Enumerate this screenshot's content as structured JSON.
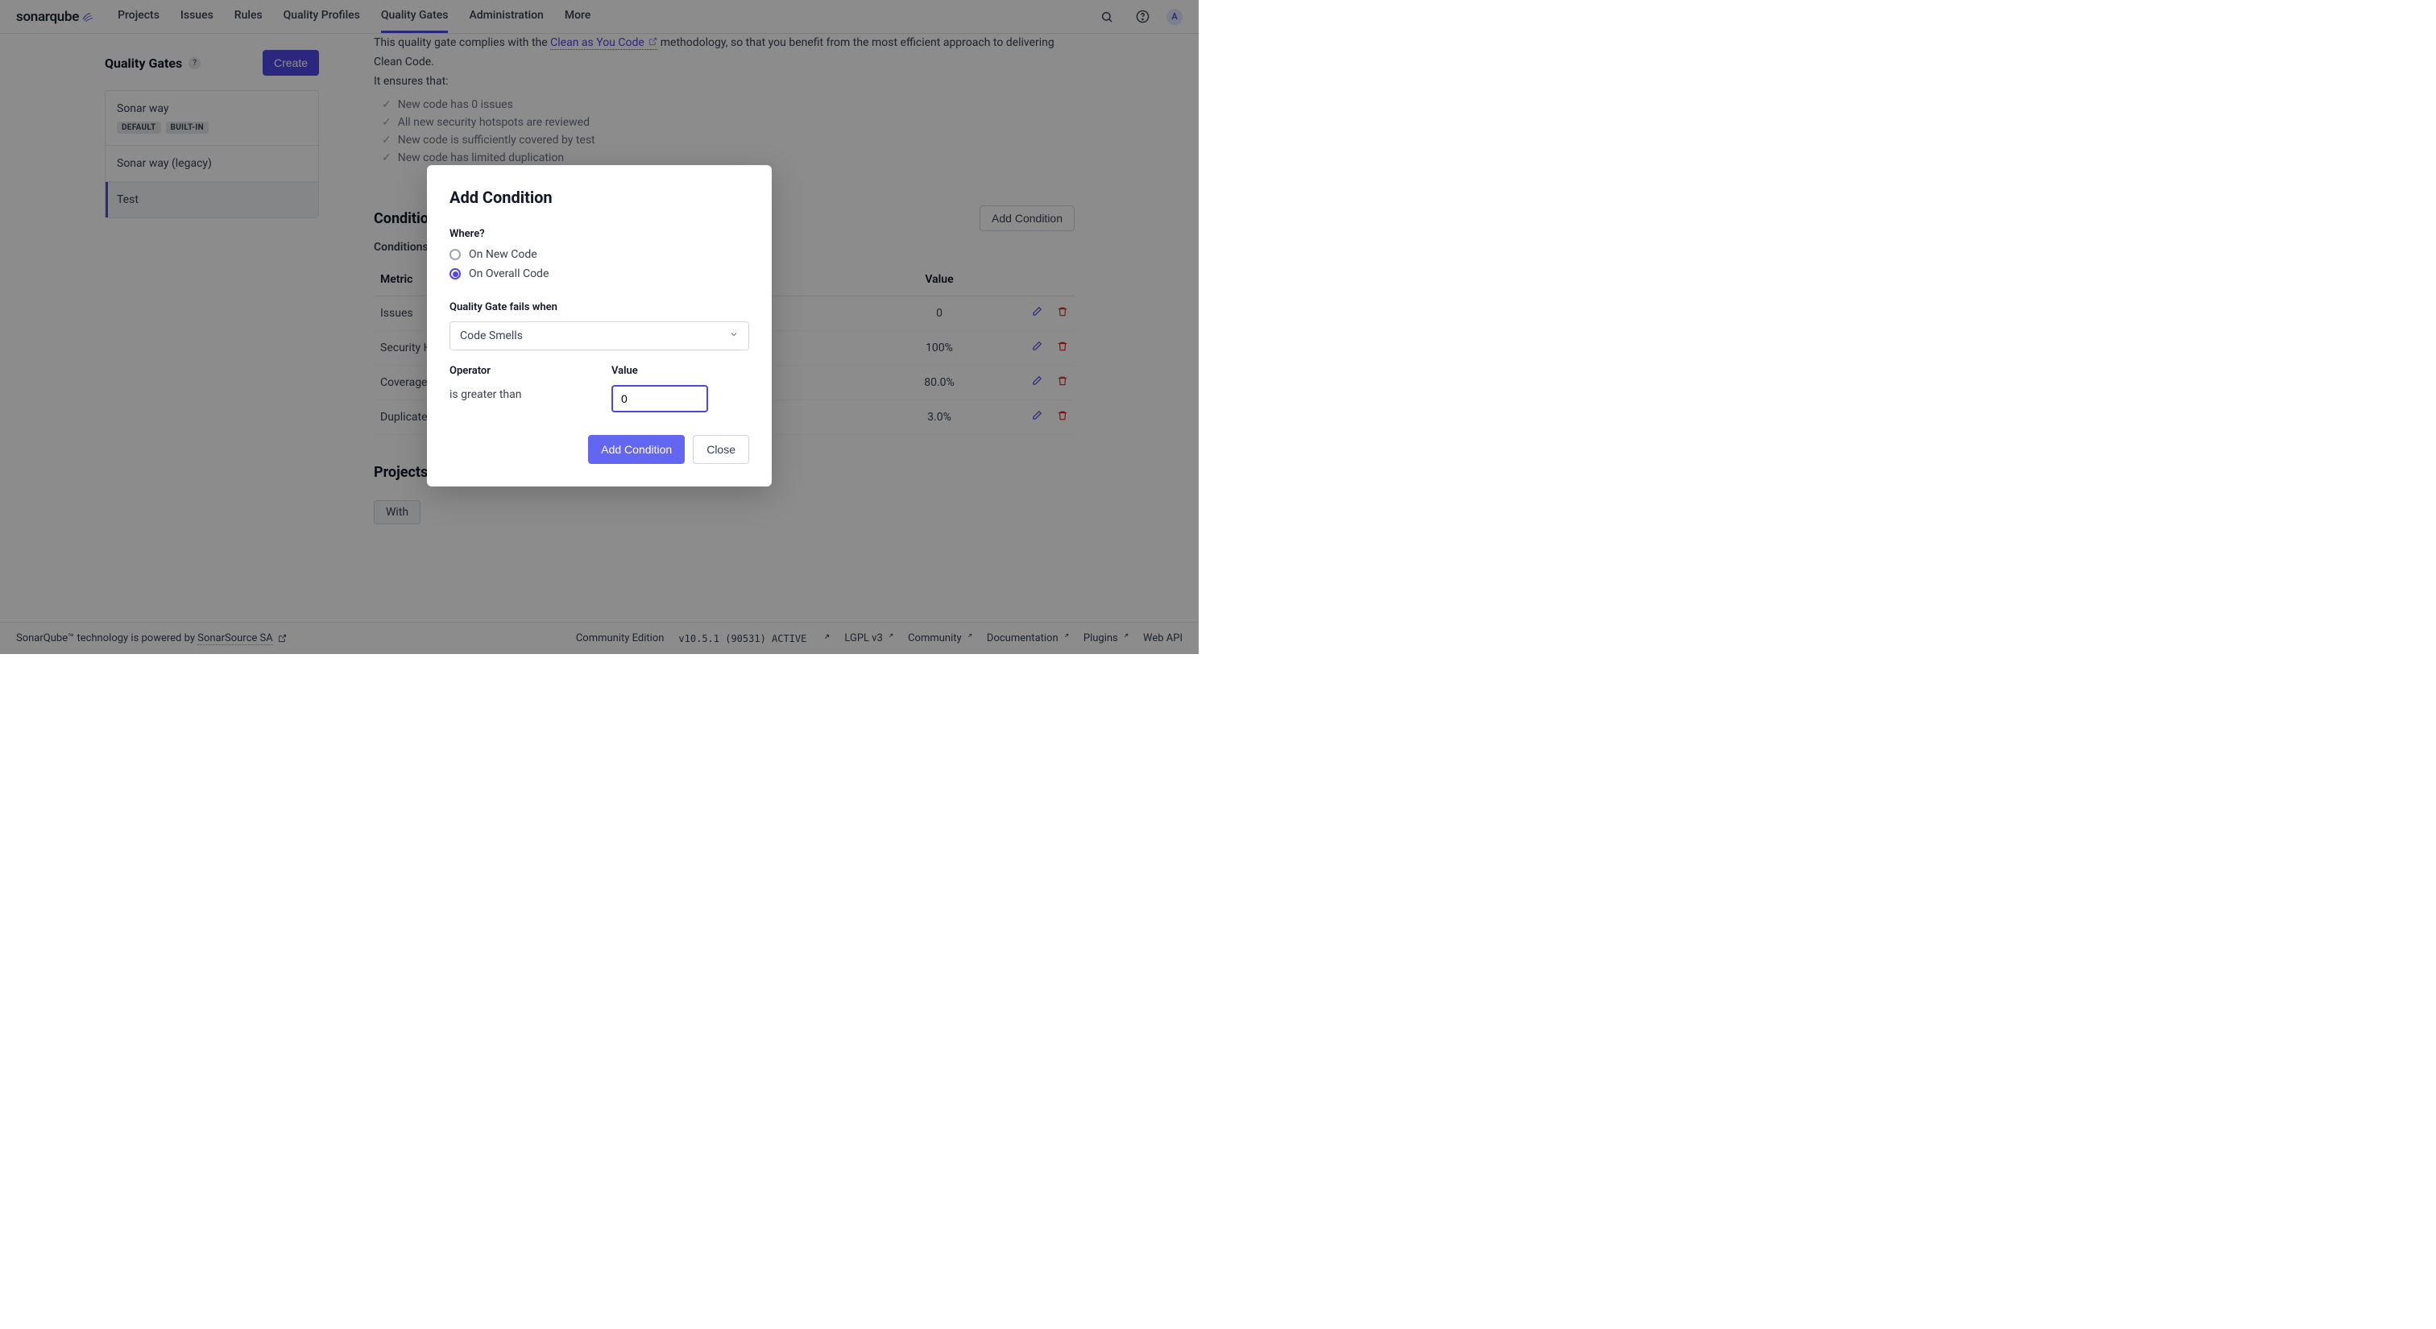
{
  "header": {
    "logo": "sonarqube",
    "nav": [
      "Projects",
      "Issues",
      "Rules",
      "Quality Profiles",
      "Quality Gates",
      "Administration",
      "More"
    ],
    "active_nav_index": 4,
    "avatar_letter": "A"
  },
  "sidebar": {
    "title": "Quality Gates",
    "create_label": "Create",
    "items": [
      {
        "name": "Sonar way",
        "badges": [
          "DEFAULT",
          "BUILT-IN"
        ],
        "active": false
      },
      {
        "name": "Sonar way (legacy)",
        "badges": [],
        "active": false
      },
      {
        "name": "Test",
        "badges": [],
        "active": true
      }
    ]
  },
  "content": {
    "intro_prefix": "This quality gate complies with the ",
    "intro_link": "Clean as You Code",
    "intro_suffix": " methodology, so that you benefit from the most efficient approach to delivering Clean Code.",
    "intro_line2": "It ensures that:",
    "checklist": [
      "New code has 0 issues",
      "All new security hotspots are reviewed",
      "New code is sufficiently covered by test",
      "New code has limited duplication"
    ],
    "conditions_title": "Conditions",
    "add_condition_label": "Add Condition",
    "conditions_subheading": "Conditions o",
    "col_metric": "Metric",
    "col_value": "Value",
    "rows": [
      {
        "metric": "Issues",
        "value": "0"
      },
      {
        "metric": "Security Ho",
        "value": "100%"
      },
      {
        "metric": "Coverage",
        "value": "80.0%"
      },
      {
        "metric": "Duplicated",
        "value": "3.0%"
      }
    ],
    "projects_title": "Projects",
    "with_label": "With"
  },
  "modal": {
    "title": "Add Condition",
    "where_label": "Where?",
    "radio_new": "On New Code",
    "radio_overall": "On Overall Code",
    "selected_radio": "overall",
    "metric_label": "Quality Gate fails when",
    "metric_selected": "Code Smells",
    "operator_label": "Operator",
    "operator_value": "is greater than",
    "value_label": "Value",
    "value_input": "0",
    "submit_label": "Add Condition",
    "close_label": "Close"
  },
  "footer": {
    "left_prefix": "SonarQube™ technology is powered by ",
    "left_link": "SonarSource SA",
    "edition": "Community Edition",
    "version": "v10.5.1 (90531) ACTIVE",
    "links": [
      "LGPL v3",
      "Community",
      "Documentation",
      "Plugins",
      "Web API"
    ]
  }
}
